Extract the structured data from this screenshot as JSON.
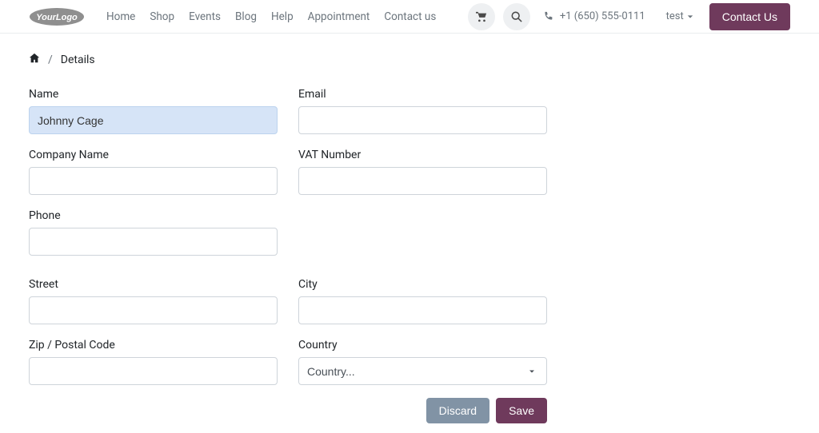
{
  "header": {
    "nav": [
      "Home",
      "Shop",
      "Events",
      "Blog",
      "Help",
      "Appointment",
      "Contact us"
    ],
    "phone": "+1 (650) 555-0111",
    "user": "test",
    "contact_btn": "Contact Us"
  },
  "breadcrumb": {
    "current": "Details"
  },
  "form": {
    "name": {
      "label": "Name",
      "value": "Johnny Cage"
    },
    "email": {
      "label": "Email",
      "value": ""
    },
    "company": {
      "label": "Company Name",
      "value": ""
    },
    "vat": {
      "label": "VAT Number",
      "value": ""
    },
    "phone": {
      "label": "Phone",
      "value": ""
    },
    "street": {
      "label": "Street",
      "value": ""
    },
    "city": {
      "label": "City",
      "value": ""
    },
    "zip": {
      "label": "Zip / Postal Code",
      "value": ""
    },
    "country": {
      "label": "Country",
      "placeholder": "Country..."
    }
  },
  "actions": {
    "discard": "Discard",
    "save": "Save"
  }
}
